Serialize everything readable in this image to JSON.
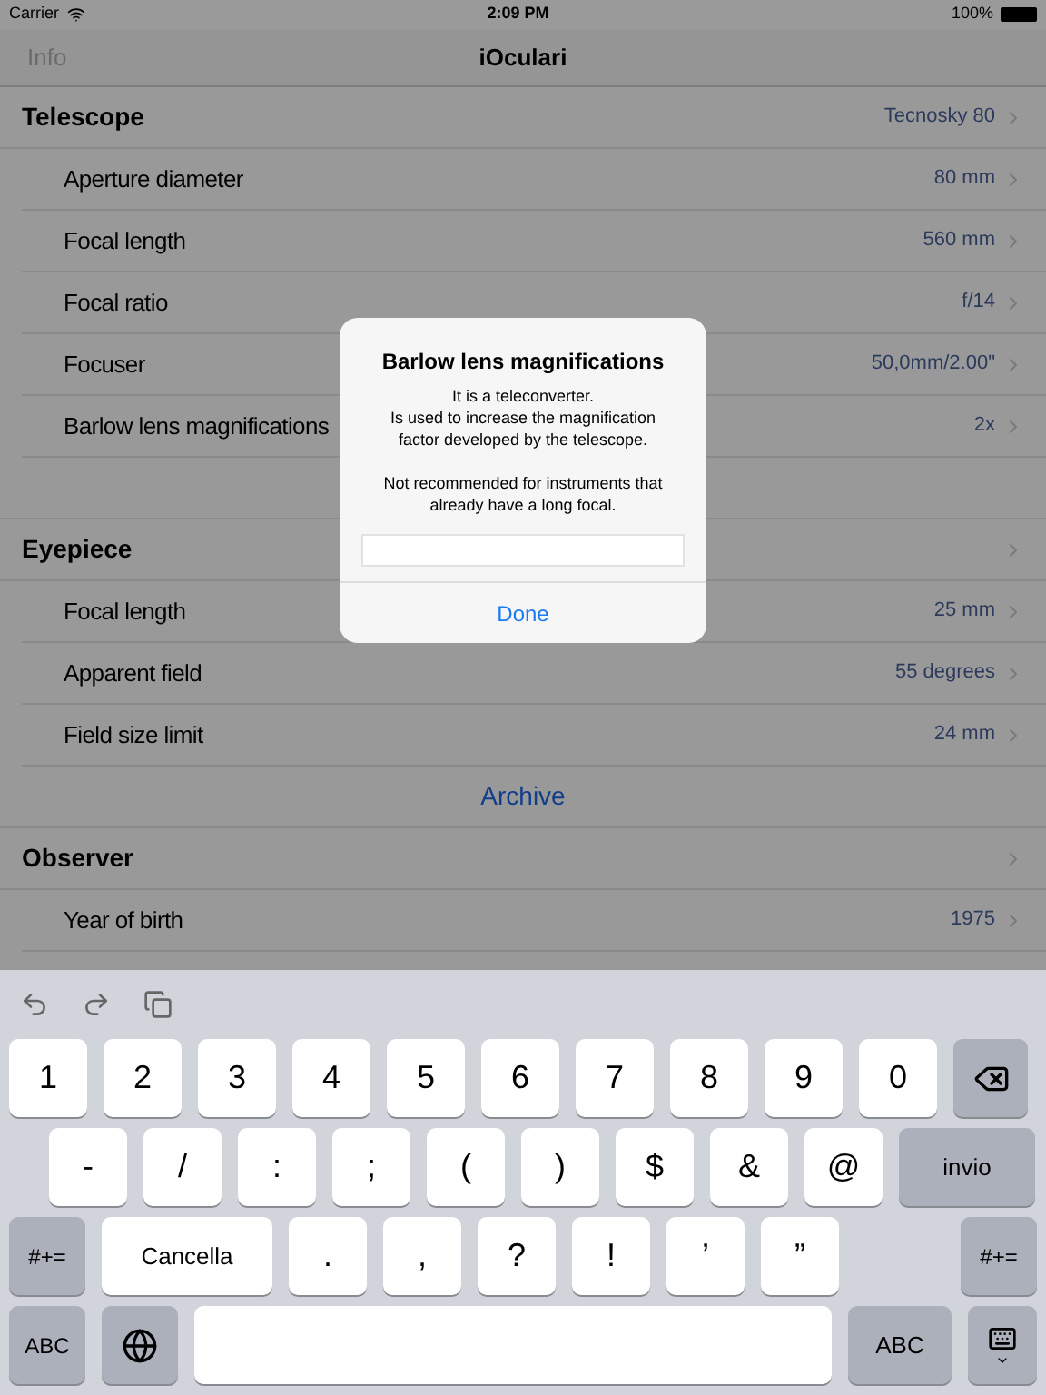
{
  "status_bar": {
    "carrier": "Carrier",
    "time": "2:09 PM",
    "battery": "100%"
  },
  "nav": {
    "left": "Info",
    "title": "iOculari"
  },
  "rows": [
    {
      "kind": "header",
      "label": "Telescope",
      "value": "Tecnosky 80"
    },
    {
      "kind": "item",
      "label": "Aperture diameter",
      "value": "80 mm"
    },
    {
      "kind": "item",
      "label": "Focal length",
      "value": "560 mm"
    },
    {
      "kind": "item",
      "label": "Focal ratio",
      "value": "f/14"
    },
    {
      "kind": "item",
      "label": "Focuser",
      "value": "50,0mm/2.00\""
    },
    {
      "kind": "item",
      "label": "Barlow lens magnifications",
      "value": "2x"
    },
    {
      "kind": "spacer"
    },
    {
      "kind": "header",
      "label": "Eyepiece"
    },
    {
      "kind": "item",
      "label": "Focal length",
      "value": "25 mm"
    },
    {
      "kind": "item",
      "label": "Apparent field",
      "value": "55 degrees"
    },
    {
      "kind": "item",
      "label": "Field size limit",
      "value": "24 mm"
    },
    {
      "kind": "link",
      "label": "Archive"
    },
    {
      "kind": "header",
      "label": "Observer"
    },
    {
      "kind": "item",
      "label": "Year of birth",
      "value": "1975"
    },
    {
      "kind": "cut"
    }
  ],
  "dialog": {
    "title": "Barlow lens magnifications",
    "paragraphs": [
      [
        "It is a teleconverter.",
        "Is used to increase the magnification",
        "factor developed by the telescope."
      ],
      [
        "Not recommended for instruments that",
        "already have a long focal."
      ]
    ],
    "button": "Done"
  },
  "keyboard": {
    "rows": [
      [
        {
          "kind": "char",
          "label": "1"
        },
        {
          "kind": "char",
          "label": "2"
        },
        {
          "kind": "char",
          "label": "3"
        },
        {
          "kind": "char",
          "label": "4"
        },
        {
          "kind": "char",
          "label": "5"
        },
        {
          "kind": "char",
          "label": "6"
        },
        {
          "kind": "char",
          "label": "7"
        },
        {
          "kind": "char",
          "label": "8"
        },
        {
          "kind": "char",
          "label": "9"
        },
        {
          "kind": "char",
          "label": "0"
        },
        {
          "kind": "backspace"
        }
      ],
      [
        {
          "kind": "char",
          "label": "-"
        },
        {
          "kind": "char",
          "label": "/"
        },
        {
          "kind": "char",
          "label": ":"
        },
        {
          "kind": "char",
          "label": ";"
        },
        {
          "kind": "char",
          "label": "("
        },
        {
          "kind": "char",
          "label": ")"
        },
        {
          "kind": "char",
          "label": "$"
        },
        {
          "kind": "char",
          "label": "&"
        },
        {
          "kind": "char",
          "label": "@"
        },
        {
          "kind": "return",
          "label": "invio"
        }
      ],
      [
        {
          "kind": "mode",
          "label": "#+="
        },
        {
          "kind": "wide",
          "label": "Cancella"
        },
        {
          "kind": "char",
          "label": "."
        },
        {
          "kind": "char",
          "label": ","
        },
        {
          "kind": "char",
          "label": "?"
        },
        {
          "kind": "char",
          "label": "!"
        },
        {
          "kind": "char",
          "label": "’"
        },
        {
          "kind": "char",
          "label": "”"
        },
        {
          "kind": "gap"
        },
        {
          "kind": "mode",
          "label": "#+="
        }
      ],
      [
        {
          "kind": "mode",
          "label": "ABC"
        },
        {
          "kind": "globe"
        },
        {
          "kind": "space"
        },
        {
          "kind": "abc",
          "label": "ABC"
        },
        {
          "kind": "dismiss"
        }
      ]
    ]
  }
}
